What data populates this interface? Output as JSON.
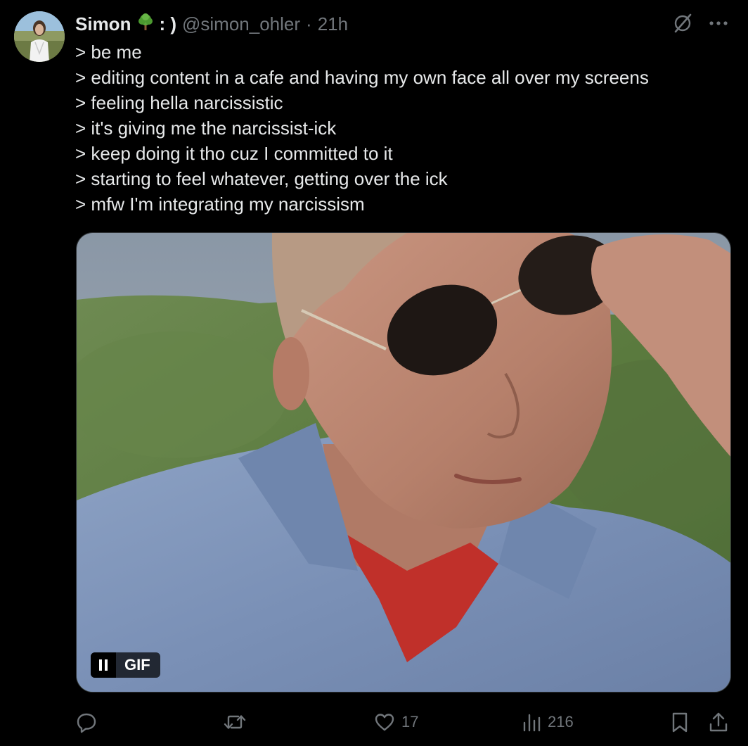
{
  "author": {
    "display_name": "Simon",
    "emoji_icon": "tree-emoji",
    "name_suffix": ": )",
    "handle": "@simon_ohler",
    "separator": "·",
    "time": "21h"
  },
  "top_actions": {
    "grok_icon": "grok-icon",
    "more_icon": "more-icon",
    "more_label": "···"
  },
  "text_lines": [
    "> be me",
    "> editing content in a cafe and having my own face all over my screens",
    "> feeling hella narcissistic",
    "> it's giving me the narcissist-ick",
    "> keep doing it tho cuz I committed to it",
    "> starting to feel whatever, getting over the ick",
    "> mfw I'm integrating my narcissism"
  ],
  "media": {
    "badge_label": "GIF",
    "pause_icon": "pause-icon"
  },
  "actions": {
    "reply_count": "",
    "retweet_count": "",
    "like_count": "17",
    "views_count": "216"
  },
  "colors": {
    "background": "#000000",
    "text_primary": "#e7e9ea",
    "text_secondary": "#71767b",
    "border": "#2f3336"
  }
}
